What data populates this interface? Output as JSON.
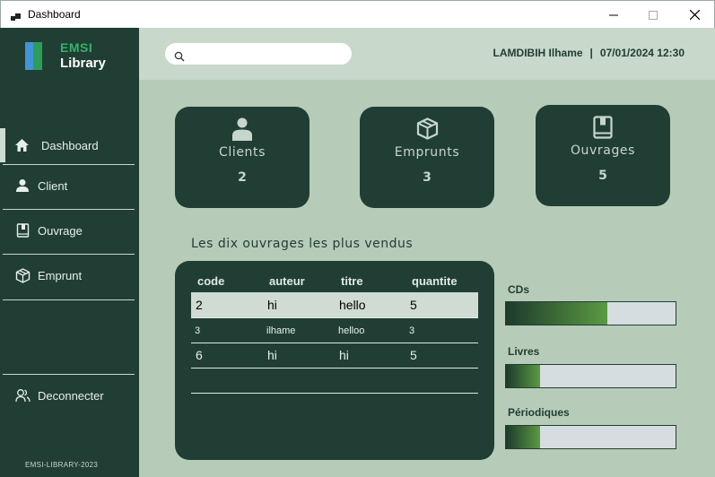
{
  "window": {
    "title": "Dashboard"
  },
  "sidebar": {
    "logo_top": "EMSI",
    "logo_bottom": "Library",
    "items": [
      {
        "label": "Dashboard",
        "icon": "home-icon"
      },
      {
        "label": "Client",
        "icon": "user-icon"
      },
      {
        "label": "Ouvrage",
        "icon": "book-icon"
      },
      {
        "label": "Emprunt",
        "icon": "box-icon"
      }
    ],
    "logout": "Deconnecter",
    "footer": "EMSI-LIBRARY-2023"
  },
  "topbar": {
    "search_value": "",
    "user": "LAMDIBIH Ilhame",
    "separator": "|",
    "datetime": "07/01/2024 12:30"
  },
  "cards": [
    {
      "label": "Clients",
      "count": "2",
      "icon": "person-icon"
    },
    {
      "label": "Emprunts",
      "count": "3",
      "icon": "box-icon"
    },
    {
      "label": "Ouvrages",
      "count": "5",
      "icon": "book-icon"
    }
  ],
  "table": {
    "title": "Les dix ouvrages les plus vendus",
    "headers": [
      "code",
      "auteur",
      "titre",
      "quantite"
    ],
    "rows": [
      [
        "2",
        "hi",
        "hello",
        "5"
      ],
      [
        "3",
        "ilhame",
        "helloo",
        "3"
      ],
      [
        "6",
        "hi",
        "hi",
        "5"
      ]
    ]
  },
  "stats": [
    {
      "label": "CDs",
      "fraction": 0.6
    },
    {
      "label": "Livres",
      "fraction": 0.2
    },
    {
      "label": "Périodiques",
      "fraction": 0.2
    }
  ],
  "colors": {
    "sidebar_bg": "#213e35",
    "main_bg": "#b6ccb8",
    "topbar_bg": "#c8d8ca",
    "accent_green": "#33b36a",
    "accent_blue": "#3f95d6"
  }
}
